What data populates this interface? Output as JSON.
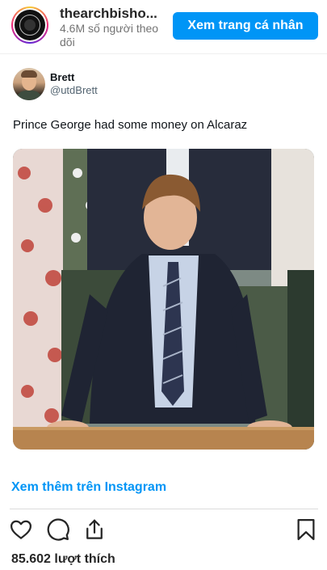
{
  "header": {
    "account_name": "thearchbisho...",
    "follower_text": "4.6M số người theo dõi",
    "view_profile_label": "Xem trang cá nhân"
  },
  "tweet": {
    "author_name": "Brett",
    "author_handle": "@utdBrett",
    "text": "Prince George had some money on Alcaraz"
  },
  "footer": {
    "view_more_label": "Xem thêm trên Instagram",
    "likes_text": "85.602 lượt thích"
  },
  "icons": {
    "like": "heart-icon",
    "comment": "comment-icon",
    "share": "share-icon",
    "save": "bookmark-icon"
  },
  "colors": {
    "accent": "#0095f6",
    "text": "#262626",
    "muted": "#737373"
  }
}
